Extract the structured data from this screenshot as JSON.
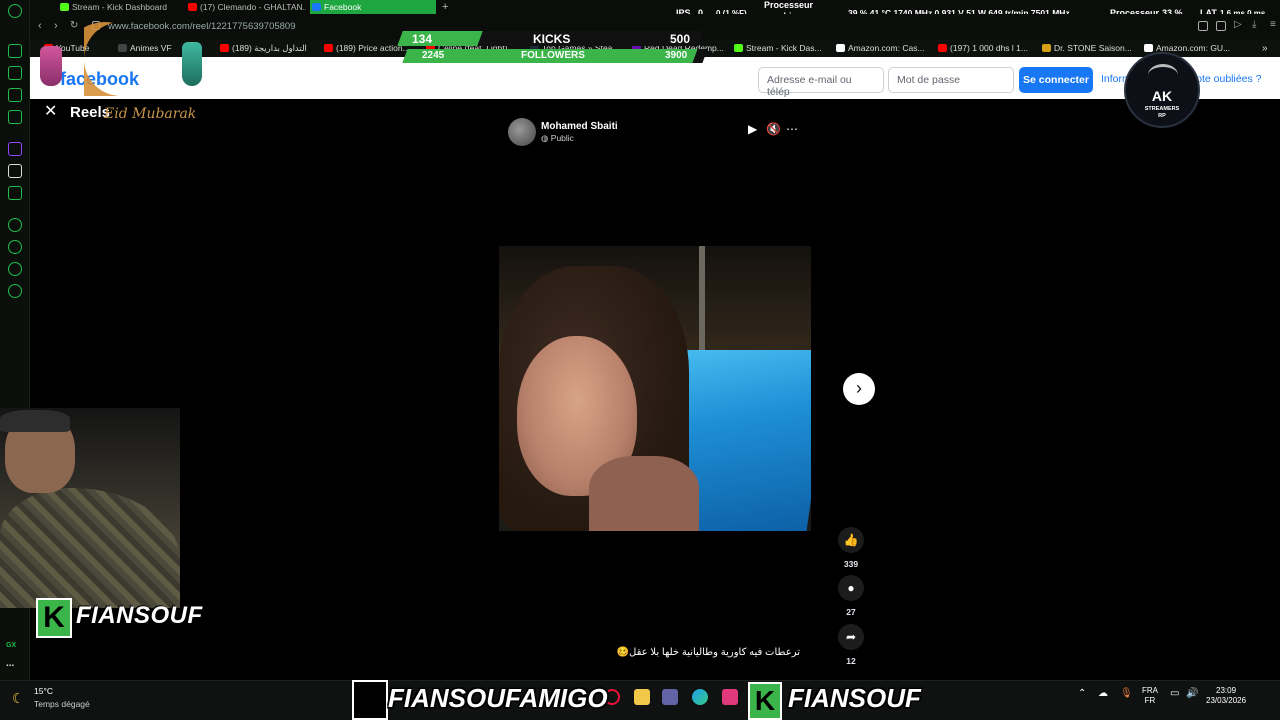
{
  "browser": {
    "tabs": [
      {
        "label": "Stream - Kick Dashboard",
        "color": "#53fc18"
      },
      {
        "label": "(17) Clemando - GHALTAN...",
        "color": "#ff0000"
      },
      {
        "label": "Facebook",
        "color": "#1877f2",
        "active": true
      }
    ],
    "new_tab_glyph": "+",
    "url": "www.facebook.com/reel/1221775639705809",
    "bookmarks": [
      {
        "label": "YouTube",
        "color": "#ff0000"
      },
      {
        "label": "Animes VF",
        "color": "#333333",
        "prefix": "FA"
      },
      {
        "label": "(189) التداول بداريجة",
        "color": "#ff0000"
      },
      {
        "label": "(189) Price action...",
        "color": "#ff0000"
      },
      {
        "label": "Celine (feat. Light)...",
        "color": "#ff0000"
      },
      {
        "label": "Top Games » Stea...",
        "color": "#1b2838"
      },
      {
        "label": "Red Dead Redemp...",
        "color": "#6a0dad"
      },
      {
        "label": "Stream - Kick Das...",
        "color": "#53fc18"
      },
      {
        "label": "Amazon.com: Cas...",
        "color": "#ffffff"
      },
      {
        "label": "(197) 1 000 dhs l 1...",
        "color": "#ff0000"
      },
      {
        "label": "Dr. STONE Saison...",
        "color": "#d4a017"
      },
      {
        "label": "Amazon.com: GU...",
        "color": "#ffffff"
      }
    ]
  },
  "hud": {
    "ips_label": "IPS",
    "ips_value": "0",
    "fps_value": "0 (1 %F)",
    "gpu_label": "Processeur graphique",
    "gpu_stats": "39 % 41 °C 1740 MHz 0.931 V 51 W 649 tr/min 7501 MHz",
    "cpu_label": "Processeur",
    "cpu_value": "33 %",
    "lat_label": "LAT",
    "lat_value": "1.6 ms 0 ms"
  },
  "kicks_overlay": {
    "kicks_current": "134",
    "kicks_label": "KICKS",
    "kicks_goal": "500",
    "followers_current": "2245",
    "followers_label": "FOLLOWERS",
    "followers_goal": "3900"
  },
  "facebook": {
    "logo": "facebook",
    "email_placeholder": "Adresse e-mail ou télép",
    "password_placeholder": "Mot de passe",
    "login_button": "Se connecter",
    "forgot_link": "Informations de compte oubliées ?"
  },
  "reel": {
    "title": "Reels",
    "overlay_text": "Eid Mubarak",
    "author": "Mohamed Sbaiti",
    "visibility": "Public",
    "likes": "339",
    "comments": "27",
    "shares": "12",
    "caption": "ترعطات فيه كاورية وطاليانية خلها بلا عقل🥴"
  },
  "streamer": {
    "name": "FIANSOUF",
    "taskbar_name_left": "FIANSOUFAMIGO",
    "taskbar_name_right": "FIANSOUF",
    "logo_big": "AK",
    "logo_sub": "STREAMERS",
    "logo_sub2": "RP"
  },
  "taskbar": {
    "temperature": "15°C",
    "weather": "Temps dégagé",
    "lang_top": "FRA",
    "lang_bottom": "FR",
    "time": "23:09",
    "date": "23/03/2026"
  },
  "sidebar": {
    "gx_label": "GX",
    "more_label": "..."
  }
}
